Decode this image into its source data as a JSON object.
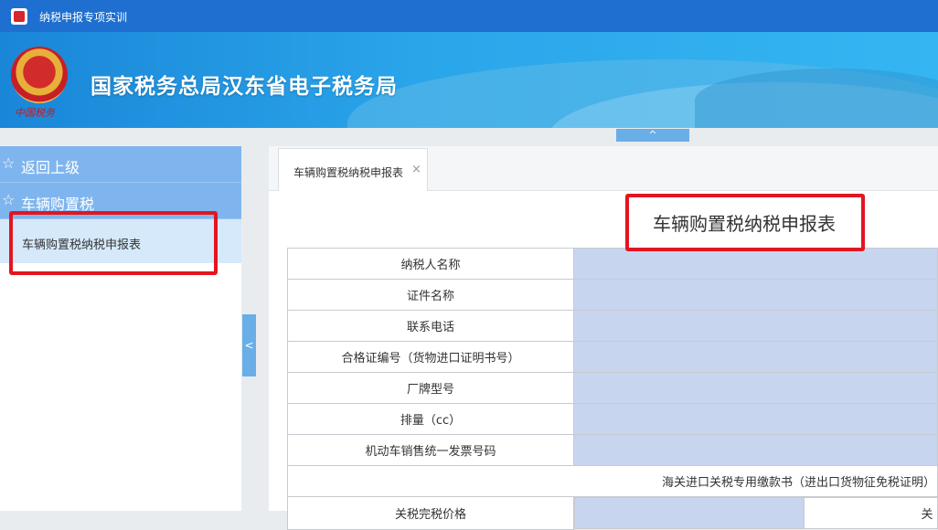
{
  "titlebar": {
    "title": "纳税申报专项实训"
  },
  "banner": {
    "bureau": "国家税务总局汉东省电子税务局",
    "emblem_text": "中国税务"
  },
  "collapse_top": "^",
  "collapse_left": "<",
  "sidebar": {
    "items": [
      {
        "icon": "star-icon",
        "label": "返回上级"
      },
      {
        "icon": "star-icon",
        "label": "车辆购置税"
      }
    ],
    "subitem": "车辆购置税纳税申报表"
  },
  "tabs": [
    {
      "label": "车辆购置税纳税申报表",
      "close": "×"
    }
  ],
  "form": {
    "title": "车辆购置税纳税申报表",
    "rows": [
      "纳税人名称",
      "证件名称",
      "联系电话",
      "合格证编号（货物进口证明书号）",
      "厂牌型号",
      "排量（cc）",
      "机动车销售统一发票号码"
    ],
    "section_header": "海关进口关税专用缴款书（进出口货物征免税证明）",
    "partial_row_label": "关税完税价格",
    "partial_row_right": "关"
  },
  "colors": {
    "titlebar": "#1e6fcf",
    "sidebar_item": "#7fb5ee",
    "sidebar_sub": "#d6e9fb",
    "input_fill": "#c8d5ef",
    "highlight": "#e3151f"
  }
}
